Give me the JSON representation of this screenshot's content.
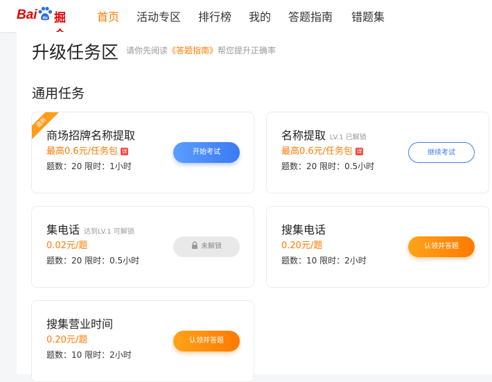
{
  "brand": {
    "logo_text_left": "Bai",
    "logo_text_right": "掘金"
  },
  "nav": {
    "items": [
      {
        "label": "首页",
        "active": true
      },
      {
        "label": "活动专区",
        "active": false
      },
      {
        "label": "排行榜",
        "active": false
      },
      {
        "label": "我的",
        "active": false
      },
      {
        "label": "答题指南",
        "active": false
      },
      {
        "label": "错题集",
        "active": false
      }
    ]
  },
  "page": {
    "title": "升级任务区",
    "subtitle_prefix": "请你先阅读",
    "subtitle_link": "《答题指南》",
    "subtitle_suffix": "帮您提升正确率"
  },
  "section": {
    "title": "通用任务"
  },
  "tasks": [
    {
      "ribbon": "最新",
      "name": "商场招牌名称提取",
      "tip": "",
      "price": "最高0.6元/任务包",
      "detail_badge": "详",
      "meta": "题数：20 限时：1小时",
      "button": "开始考试",
      "button_style": "blue"
    },
    {
      "name": "名称提取",
      "tip": "LV.1 已解锁",
      "price": "最高0.6元/任务包",
      "detail_badge": "详",
      "meta": "题数：20 限时：0.5小时",
      "button": "继续考试",
      "button_style": "outline"
    },
    {
      "name": "集电话",
      "tip": "达到LV.1 可解锁",
      "price": "0.02元/题",
      "meta": "题数：20 限时：0.5小时",
      "button": "未解锁",
      "button_style": "gray",
      "button_icon": "lock-icon"
    },
    {
      "name": "搜集电话",
      "tip": "",
      "price": "0.20元/题",
      "meta": "题数：10 限时：2小时",
      "button": "认领并答题",
      "button_style": "orange"
    },
    {
      "name": "搜集营业时间",
      "tip": "",
      "price": "0.20元/题",
      "meta": "题数：10 限时：2小时",
      "button": "认领并答题",
      "button_style": "orange"
    }
  ],
  "colors": {
    "accent": "#ff7a00",
    "brand_red": "#e10602",
    "blue": "#3a7bf2"
  }
}
